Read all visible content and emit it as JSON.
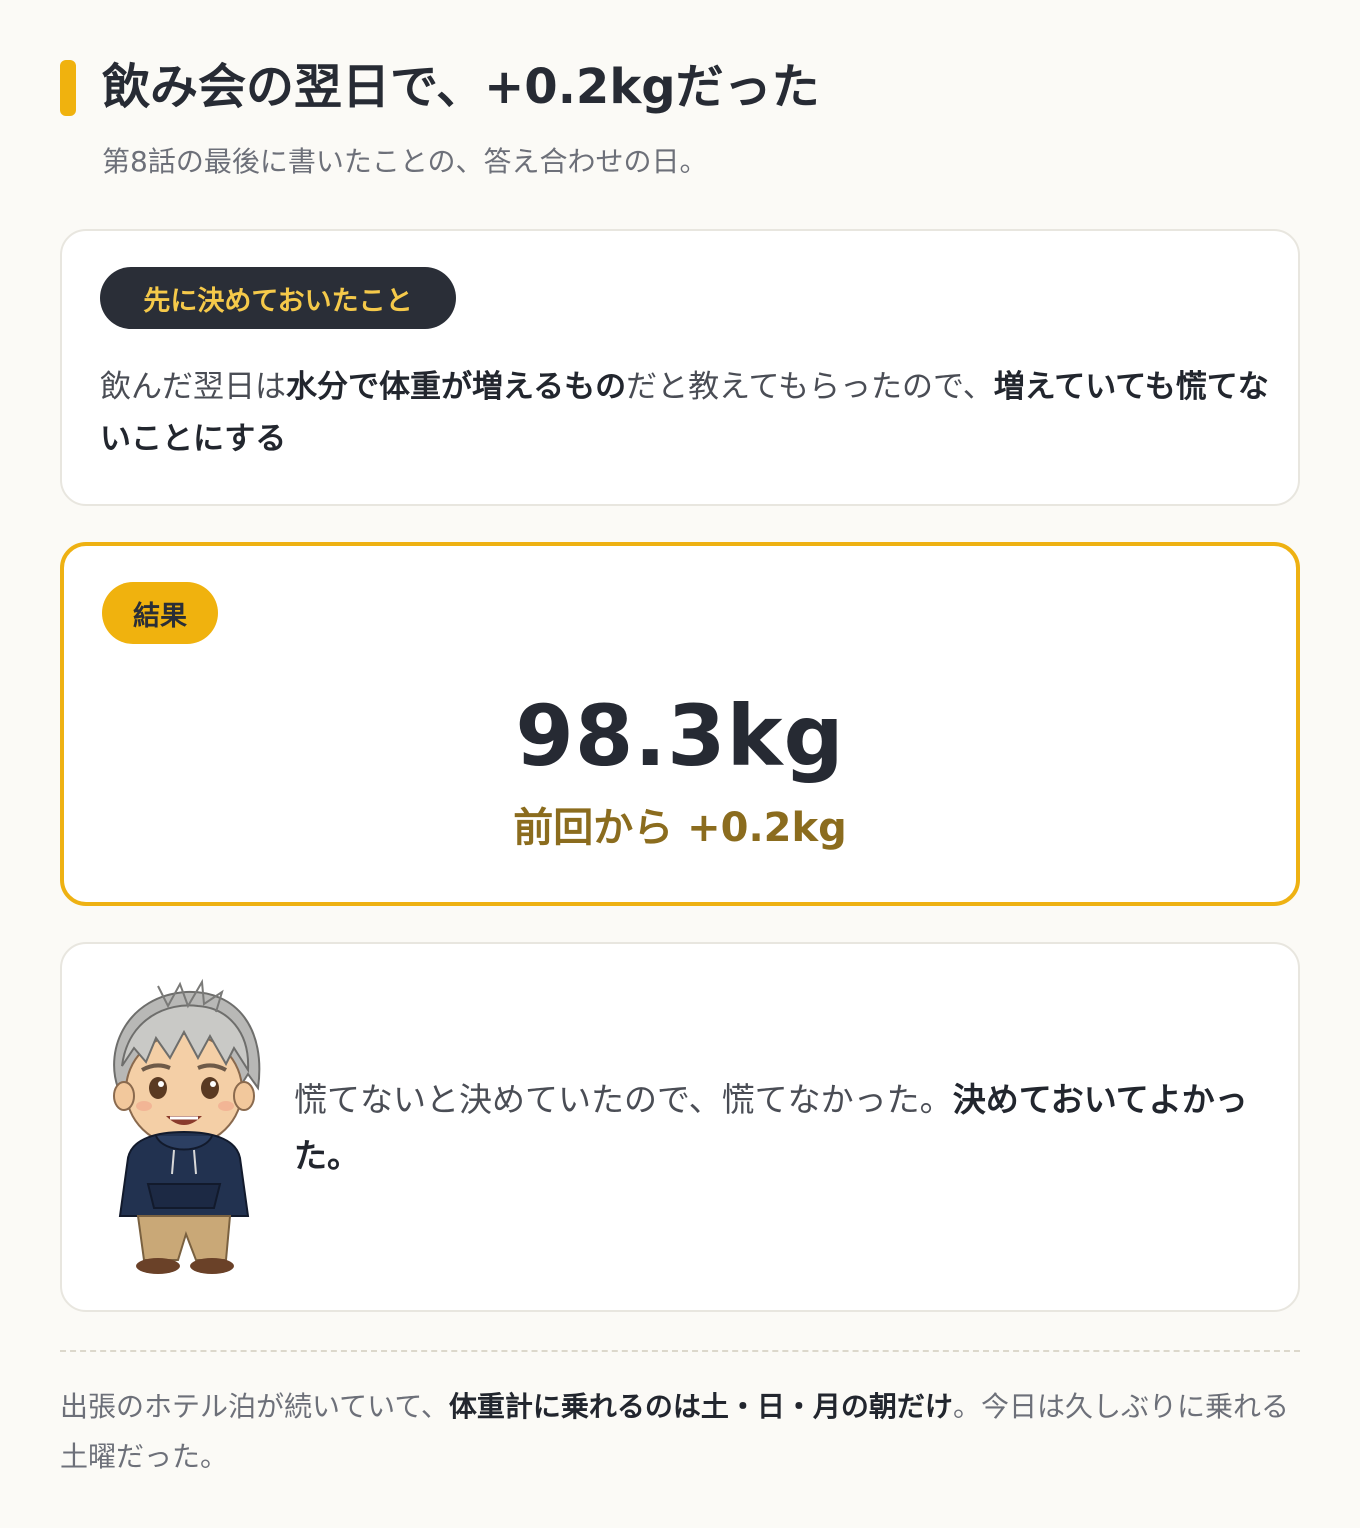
{
  "header": {
    "title": "飲み会の翌日で、+0.2kgだった",
    "subtitle": "第8話の最後に書いたことの、答え合わせの日。"
  },
  "rule_card": {
    "badge": "先に決めておいたこと",
    "text_1": "飲んだ翌日は",
    "text_2_bold": "水分で体重が増えるもの",
    "text_3": "だと教えてもらったので、",
    "text_4_bold": "増えていても慌てないことにする"
  },
  "result_card": {
    "badge": "結果",
    "weight": "98.3kg",
    "diff": "前回から +0.2kg"
  },
  "comment_card": {
    "avatar": "character-avatar",
    "text_1": "慌てないと決めていたので、慌てなかった。",
    "text_2_bold": "決めておいてよかった。"
  },
  "footer": {
    "text_1": "出張のホテル泊が続いていて、",
    "text_2_bold": "体重計に乗れるのは土・日・月の朝だけ",
    "text_3": "。今日は久しぶりに乗れる土曜だった。"
  },
  "colors": {
    "accent": "#f0b20e",
    "dark": "#2a2e37",
    "diff_text": "#8b6c1e",
    "background": "#fbfaf6"
  }
}
